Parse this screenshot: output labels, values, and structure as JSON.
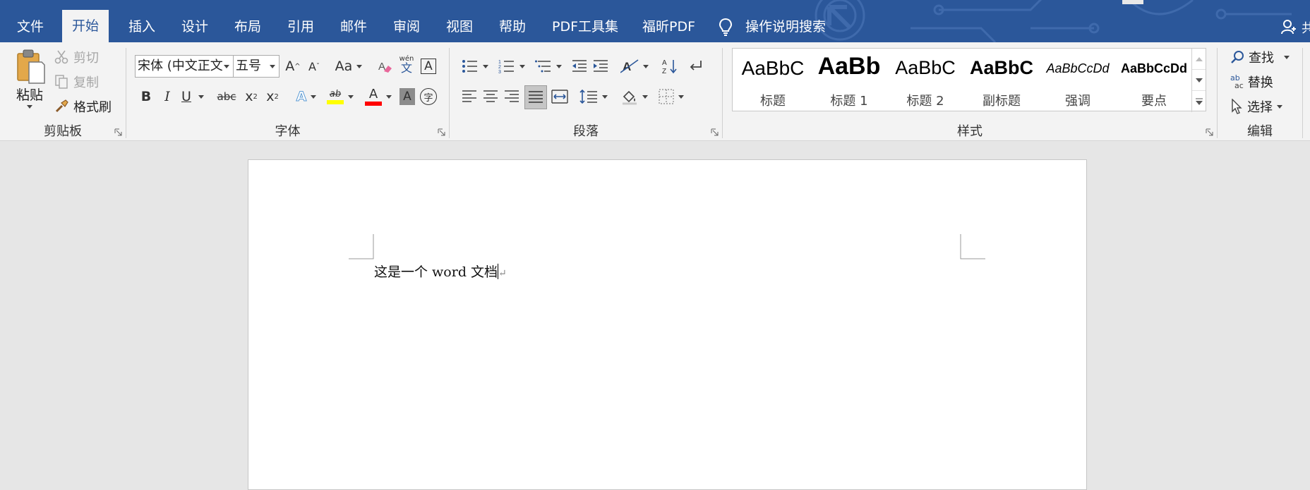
{
  "tabs": [
    {
      "label": "文件"
    },
    {
      "label": "开始"
    },
    {
      "label": "插入"
    },
    {
      "label": "设计"
    },
    {
      "label": "布局"
    },
    {
      "label": "引用"
    },
    {
      "label": "邮件"
    },
    {
      "label": "审阅"
    },
    {
      "label": "视图"
    },
    {
      "label": "帮助"
    },
    {
      "label": "PDF工具集"
    },
    {
      "label": "福昕PDF"
    }
  ],
  "tell_me": {
    "label": "操作说明搜索",
    "icon": "lightbulb-icon"
  },
  "user_partial": "共",
  "clipboard": {
    "label": "剪贴板",
    "paste": "粘贴",
    "cut": "剪切",
    "copy": "复制",
    "format_painter": "格式刷"
  },
  "font": {
    "label": "字体",
    "font_name": "宋体 (中文正文",
    "font_size": "五号",
    "grow": "A",
    "shrink": "A",
    "change_case": "Aa",
    "phonetic": "wén",
    "phonetic_char": "文",
    "char_border": "A",
    "bold": "B",
    "italic": "I",
    "underline": "U",
    "strike": "abc",
    "subscript": "x",
    "subscript_mark": "2",
    "superscript": "x",
    "superscript_mark": "2",
    "text_effect": "A",
    "highlight": "ab",
    "font_color": "A",
    "char_shading": "A",
    "enclose": "字"
  },
  "paragraph": {
    "label": "段落"
  },
  "styles": {
    "label": "样式",
    "items": [
      {
        "sample": "AaBbC",
        "name": "标题"
      },
      {
        "sample": "AaBb",
        "name": "标题 1"
      },
      {
        "sample": "AaBbC",
        "name": "标题 2"
      },
      {
        "sample": "AaBbC",
        "name": "副标题"
      },
      {
        "sample": "AaBbCcDd",
        "name": "强调"
      },
      {
        "sample": "AaBbCcDd",
        "name": "要点"
      }
    ]
  },
  "editing": {
    "label": "编辑",
    "find": "查找",
    "replace": "替换",
    "replace_icon_top": "ab",
    "replace_icon_bottom": "ac",
    "select": "选择"
  },
  "document": {
    "text": "这是一个 word 文档"
  },
  "colors": {
    "accent": "#2b579a",
    "highlight": "#ffff00",
    "font_color": "#ff0000"
  }
}
